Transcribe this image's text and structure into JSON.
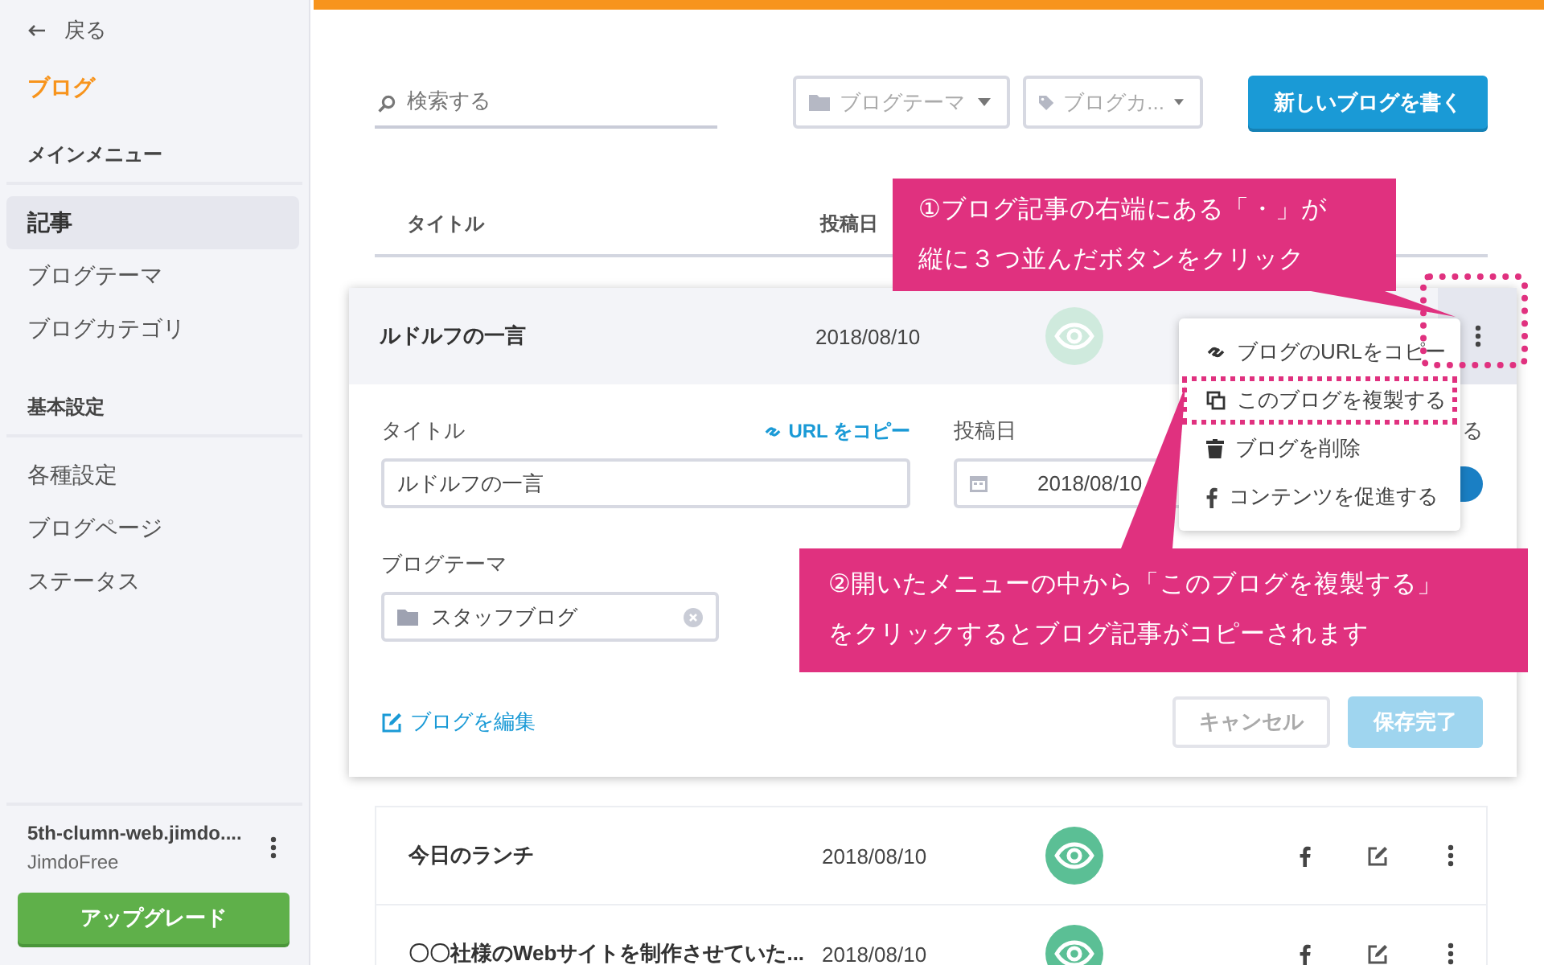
{
  "sidebar": {
    "back_label": "戻る",
    "title": "ブログ",
    "sections": [
      {
        "heading": "メインメニュー",
        "items": [
          {
            "label": "記事",
            "selected": true
          },
          {
            "label": "ブログテーマ",
            "selected": false
          },
          {
            "label": "ブログカテゴリ",
            "selected": false
          }
        ]
      },
      {
        "heading": "基本設定",
        "items": [
          {
            "label": "各種設定",
            "selected": false
          },
          {
            "label": "ブログページ",
            "selected": false
          },
          {
            "label": "ステータス",
            "selected": false
          }
        ]
      }
    ],
    "site": {
      "name": "5th-clumn-web.jimdo....",
      "plan": "JimdoFree"
    },
    "upgrade_button": "アップグレード"
  },
  "toolbar": {
    "search": {
      "placeholder": "検索する"
    },
    "filters": [
      {
        "kind": "folder",
        "placeholder": "ブログテーマ"
      },
      {
        "kind": "tag",
        "placeholder": "ブログカ..."
      }
    ],
    "new_button": "新しいブログを書く"
  },
  "table": {
    "columns": [
      "タイトル",
      "投稿日"
    ],
    "expanded_post": {
      "title": "ルドルフの一言",
      "date": "2018/08/10",
      "more_highlighted": true,
      "menu": [
        {
          "kind": "link",
          "label": "ブログのURLをコピー",
          "highlighted": false
        },
        {
          "kind": "copy",
          "label": "このブログを複製する",
          "highlighted": true
        },
        {
          "kind": "trash",
          "label": "ブログを削除",
          "highlighted": false
        },
        {
          "kind": "facebook",
          "label": "コンテンツを促進する",
          "highlighted": false
        }
      ],
      "form": {
        "title_label": "タイトル",
        "copy_url_link": "URL をコピー",
        "title_value": "ルドルフの一言",
        "date_label": "投稿日",
        "date_value": "2018/08/10",
        "publish_label": "る",
        "publish_on": true,
        "theme_label": "ブログテーマ",
        "theme_value": "スタッフブログ",
        "edit_link": "ブログを編集",
        "cancel_button": "キャンセル",
        "save_button": {
          "label": "保存完了",
          "disabled": true
        }
      }
    },
    "rows": [
      {
        "title": "今日のランチ",
        "date": "2018/08/10"
      },
      {
        "title": "〇〇社様のWebサイトを制作させていた...",
        "date": "2018/08/10"
      }
    ]
  },
  "callouts": [
    {
      "lines": [
        "①ブログ記事の右端にある「・」が",
        "縦に３つ並んだボタンをクリック"
      ]
    },
    {
      "lines": [
        "②開いたメニューの中から「このブログを複製する」",
        "をクリックするとブログ記事がコピーされます"
      ]
    }
  ]
}
